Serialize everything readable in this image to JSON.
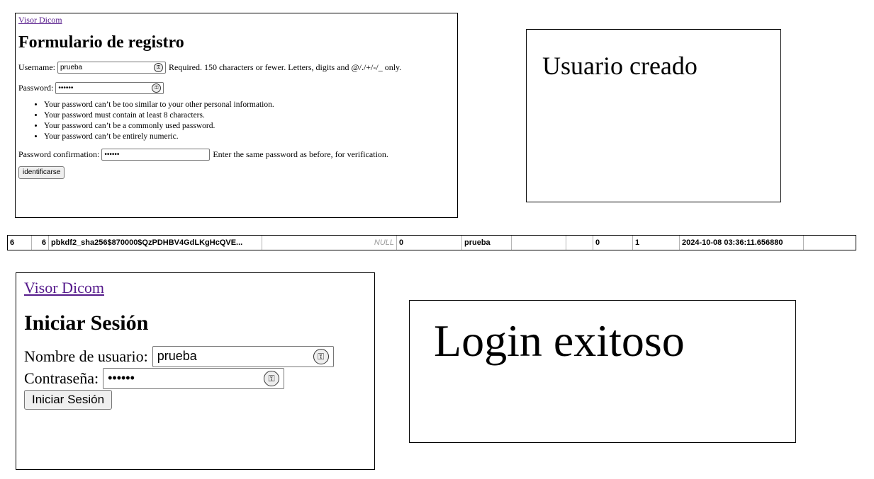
{
  "register": {
    "link": "Visor Dicom",
    "title": "Formulario de registro",
    "username_label": "Username:",
    "username_value": "prueba",
    "username_help": "Required. 150 characters or fewer. Letters, digits and @/./+/-/_ only.",
    "password_label": "Password:",
    "password_value": "••••••",
    "rules": [
      "Your password can’t be too similar to your other personal information.",
      "Your password must contain at least 8 characters.",
      "Your password can’t be a commonly used password.",
      "Your password can’t be entirely numeric."
    ],
    "confirm_label": "Password confirmation:",
    "confirm_value": "••••••",
    "confirm_help": "Enter the same password as before, for verification.",
    "submit_label": "identificarse"
  },
  "created": {
    "message": "Usuario creado"
  },
  "db_row": {
    "cells": [
      "6",
      "6",
      "pbkdf2_sha256$870000$QzPDHBV4GdLKgHcQVE...",
      "",
      "NULL",
      "0",
      "prueba",
      "",
      "",
      "0",
      "1",
      "2024-10-08 03:36:11.656880",
      ""
    ]
  },
  "login": {
    "link": "Visor Dicom",
    "title": "Iniciar Sesión",
    "username_label": "Nombre de usuario:",
    "username_value": "prueba",
    "password_label": "Contraseña:",
    "password_value": "••••••",
    "submit_label": "Iniciar Sesión"
  },
  "success": {
    "message": "Login exitoso"
  },
  "icons": {
    "password_manager": "key-icon"
  }
}
